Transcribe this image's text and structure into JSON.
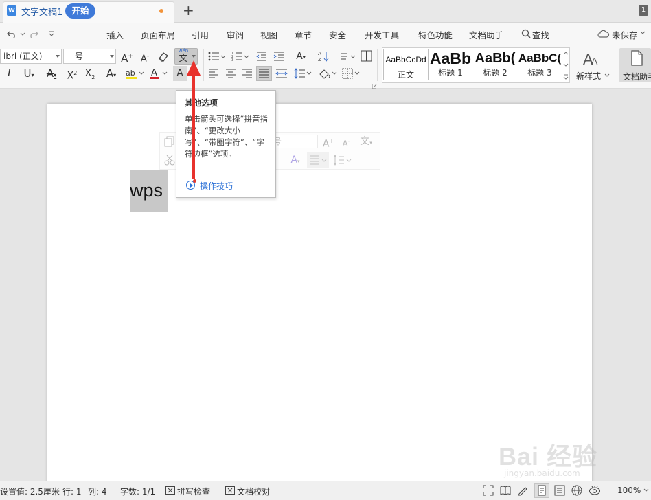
{
  "titlebar": {
    "doc_title": "文字文稿1",
    "new_tab": "+",
    "window_badge": "1",
    "doc_icon_letter": "W"
  },
  "menubar": {
    "items": [
      "开始",
      "插入",
      "页面布局",
      "引用",
      "审阅",
      "视图",
      "章节",
      "安全",
      "开发工具",
      "特色功能",
      "文档助手",
      "查找"
    ],
    "unsaved": "未保存"
  },
  "ribbon": {
    "font_name": "ibri (正文)",
    "font_size": "一号",
    "phonetic_top": "wén",
    "phonetic_char": "文",
    "styles": [
      {
        "sample": "AaBbCcDd",
        "label": "正文"
      },
      {
        "sample": "AaBb",
        "label": "标题 1"
      },
      {
        "sample": "AaBb(",
        "label": "标题 2"
      },
      {
        "sample": "AaBbC(",
        "label": "标题 3"
      }
    ],
    "new_style": "新样式",
    "doc_helper": "文档助手",
    "accent_color": "#3f7ad9"
  },
  "tooltip": {
    "title": "其他选项",
    "body": "单击箭头可选择“拼音指南”、“更改大小写”、“带圈字符”、“字符边框”选项。",
    "link": "操作技巧"
  },
  "minitoolbar": {
    "font_size": "号"
  },
  "document": {
    "text": "wps"
  },
  "statusbar": {
    "setting": "设置值: 2.5厘米",
    "row": "行: 1",
    "col": "列: 4",
    "words": "字数: 1/1",
    "spell": "拼写检查",
    "proof": "文档校对",
    "zoom": "100%"
  },
  "watermark": {
    "brand": "Bai 经验",
    "url": "jingyan.baidu.com"
  }
}
